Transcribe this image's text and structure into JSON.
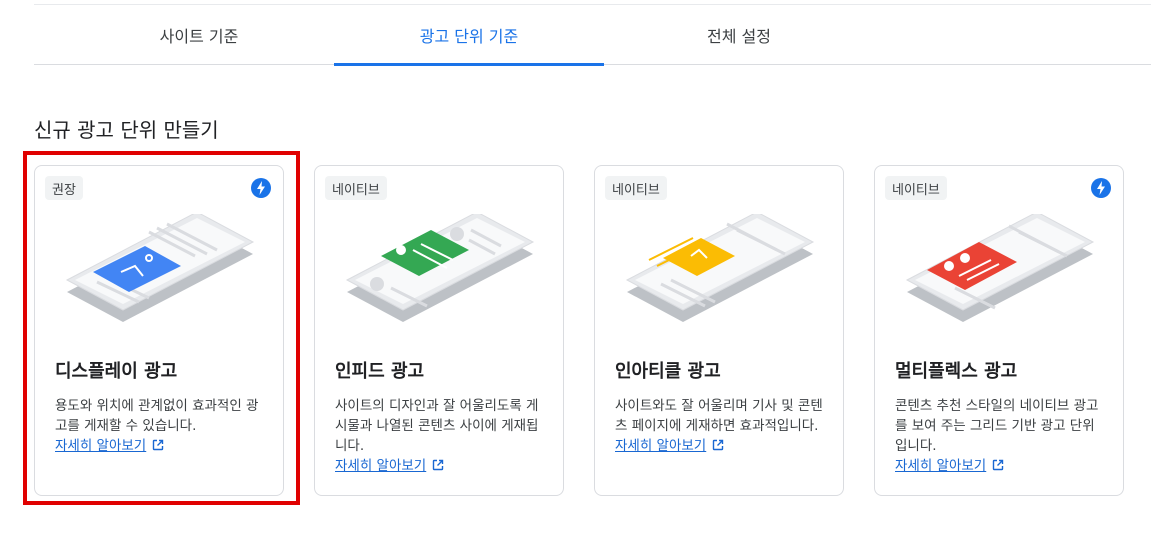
{
  "tabs": [
    {
      "label": "사이트 기준",
      "active": false
    },
    {
      "label": "광고 단위 기준",
      "active": true
    },
    {
      "label": "전체 설정",
      "active": false
    }
  ],
  "section_title": "신규 광고 단위 만들기",
  "cards": [
    {
      "badge": "권장",
      "has_bolt_icon": true,
      "title": "디스플레이 광고",
      "description": "용도와 위치에 관계없이 효과적인 광고를 게재할 수 있습니다.",
      "link": "자세히 알아보기",
      "accent": "#4285f4",
      "highlighted": true
    },
    {
      "badge": "네이티브",
      "has_bolt_icon": false,
      "title": "인피드 광고",
      "description": "사이트의 디자인과 잘 어울리도록 게시물과 나열된 콘텐츠 사이에 게재됩니다.",
      "link": "자세히 알아보기",
      "accent": "#34a853"
    },
    {
      "badge": "네이티브",
      "has_bolt_icon": false,
      "title": "인아티클 광고",
      "description": "사이트와도 잘 어울리며 기사 및 콘텐츠 페이지에 게재하면 효과적입니다.",
      "link": "자세히 알아보기",
      "accent": "#fbbc04"
    },
    {
      "badge": "네이티브",
      "has_bolt_icon": true,
      "title": "멀티플렉스 광고",
      "description": "콘텐츠 추천 스타일의 네이티브 광고를 보여 주는 그리드 기반 광고 단위입니다.",
      "link": "자세히 알아보기",
      "accent": "#ea4335"
    }
  ],
  "colors": {
    "primary": "#1a73e8",
    "link": "#1967d2",
    "highlight_border": "#e00000"
  },
  "icons": {
    "bolt": "lightning-bolt-icon",
    "external": "external-link-icon"
  }
}
